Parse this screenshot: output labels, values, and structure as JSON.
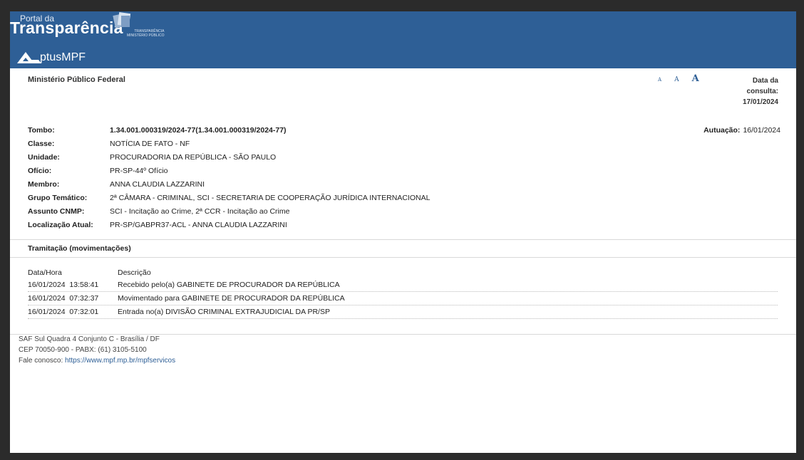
{
  "banner": {
    "portal_small": "Portal da",
    "portal_big": "Transparência",
    "portal_sub_1": "TRANSPARÊNCIA",
    "portal_sub_2": "MINISTÉRIO PÚBLICO",
    "app_name": "ptusMPF"
  },
  "header": {
    "org": "Ministério Público Federal",
    "font_small": "A",
    "font_medium": "A",
    "font_large": "A",
    "consult_label_1": "Data da",
    "consult_label_2": "consulta:",
    "consult_date": "17/01/2024"
  },
  "process": {
    "fields": [
      {
        "label": "Tombo:",
        "value": "1.34.001.000319/2024-77(1.34.001.000319/2024-77)"
      },
      {
        "label": "Classe:",
        "value": "NOTÍCIA DE FATO - NF"
      },
      {
        "label": "Unidade:",
        "value": "PROCURADORIA DA REPÚBLICA - SÃO PAULO"
      },
      {
        "label": "Ofício:",
        "value": "PR-SP-44º Ofício"
      },
      {
        "label": "Membro:",
        "value": "ANNA CLAUDIA LAZZARINI"
      },
      {
        "label": "Grupo Temático:",
        "value": "2ª CÂMARA - CRIMINAL, SCI - SECRETARIA DE COOPERAÇÃO JURÍDICA INTERNACIONAL"
      },
      {
        "label": "Assunto CNMP:",
        "value": "SCI - Incitação ao Crime, 2ª CCR - Incitação ao Crime"
      },
      {
        "label": "Localização Atual:",
        "value": "PR-SP/GABPR37-ACL - ANNA CLAUDIA LAZZARINI"
      }
    ],
    "autuacao_label": "Autuação:",
    "autuacao_date": "16/01/2024"
  },
  "movements": {
    "title": "Tramitação (movimentações)",
    "col_date": "Data/Hora",
    "col_desc": "Descrição",
    "rows": [
      {
        "datetime": "16/01/2024  13:58:41",
        "desc": "Recebido pelo(a) GABINETE DE PROCURADOR DA REPÚBLICA"
      },
      {
        "datetime": "16/01/2024  07:32:37",
        "desc": "Movimentado para GABINETE DE PROCURADOR DA REPÚBLICA"
      },
      {
        "datetime": "16/01/2024  07:32:01",
        "desc": "Entrada no(a) DIVISÃO CRIMINAL EXTRAJUDICIAL DA PR/SP"
      }
    ]
  },
  "footer": {
    "address": "SAF Sul Quadra 4 Conjunto C - Brasília / DF",
    "cep": "CEP 70050-900 - PABX: (61) 3105-5100",
    "contact_label": "Fale conosco: ",
    "contact_link": "https://www.mpf.mp.br/mpfservicos"
  },
  "colors": {
    "banner": "#2e5f96",
    "link": "#2e5f96"
  }
}
